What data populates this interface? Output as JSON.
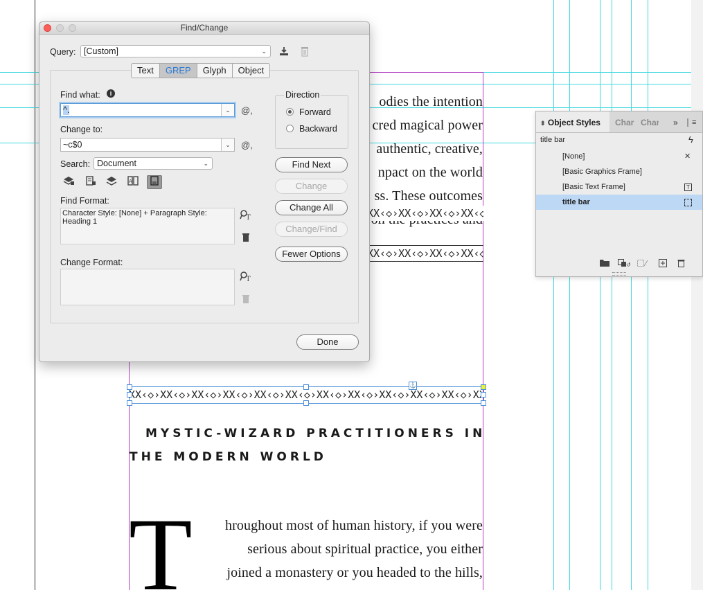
{
  "document": {
    "body_lines_top": [
      "odies the intention",
      "cred magical power",
      "authentic, creative,",
      "npact on the world",
      "ss. These outcomes",
      "on the practices and"
    ],
    "ornament_text": "XX‹◇›XX‹◇›XX‹◇›XX‹◇›XX‹◇›XX‹◇›XX‹◇›XX‹◇›XX‹◇›XX‹◇›XX‹◇›XX‹◇›",
    "heading_line_1": "MYSTIC-WIZARD PRACTITIONERS IN",
    "heading_line_2": "THE MODERN WORLD",
    "drop_cap": "T",
    "body_lines_bottom": [
      "hroughout most of human history, if you were",
      "serious about spiritual practice, you either",
      "joined a monastery or you headed to the hills,"
    ]
  },
  "find_change": {
    "title": "Find/Change",
    "query_label": "Query:",
    "query_value": "[Custom]",
    "tabs": [
      {
        "label": "Text",
        "active": false
      },
      {
        "label": "GREP",
        "active": true
      },
      {
        "label": "Glyph",
        "active": false
      },
      {
        "label": "Object",
        "active": false
      }
    ],
    "find_what_label": "Find what:",
    "find_what_value": "^.",
    "change_to_label": "Change to:",
    "change_to_value": "~c$0",
    "special_char_symbol": "@,",
    "search_label": "Search:",
    "search_value": "Document",
    "direction_label": "Direction",
    "direction_forward": "Forward",
    "direction_backward": "Backward",
    "direction_selected": "Forward",
    "buttons": {
      "find_next": "Find Next",
      "change": "Change",
      "change_all": "Change All",
      "change_find": "Change/Find",
      "fewer_options": "Fewer Options",
      "done": "Done"
    },
    "find_format_label": "Find Format:",
    "find_format_value": "Character Style: [None] + Paragraph Style: Heading 1",
    "change_format_label": "Change Format:",
    "change_format_value": ""
  },
  "object_styles": {
    "tab_active": "Object Styles",
    "tab_2": "Char",
    "tab_3": "Char",
    "current_style": "title bar",
    "items": [
      {
        "label": "[None]",
        "selected": false
      },
      {
        "label": "[Basic Graphics Frame]",
        "selected": false
      },
      {
        "label": "[Basic Text Frame]",
        "selected": false
      },
      {
        "label": "title bar",
        "selected": true
      }
    ]
  },
  "colors": {
    "guide": "#3fd7e0",
    "margin": "#b13cc0",
    "selection": "#4a90d9",
    "active_tab_text": "#2a7ad6",
    "close_button": "#fc605b"
  }
}
